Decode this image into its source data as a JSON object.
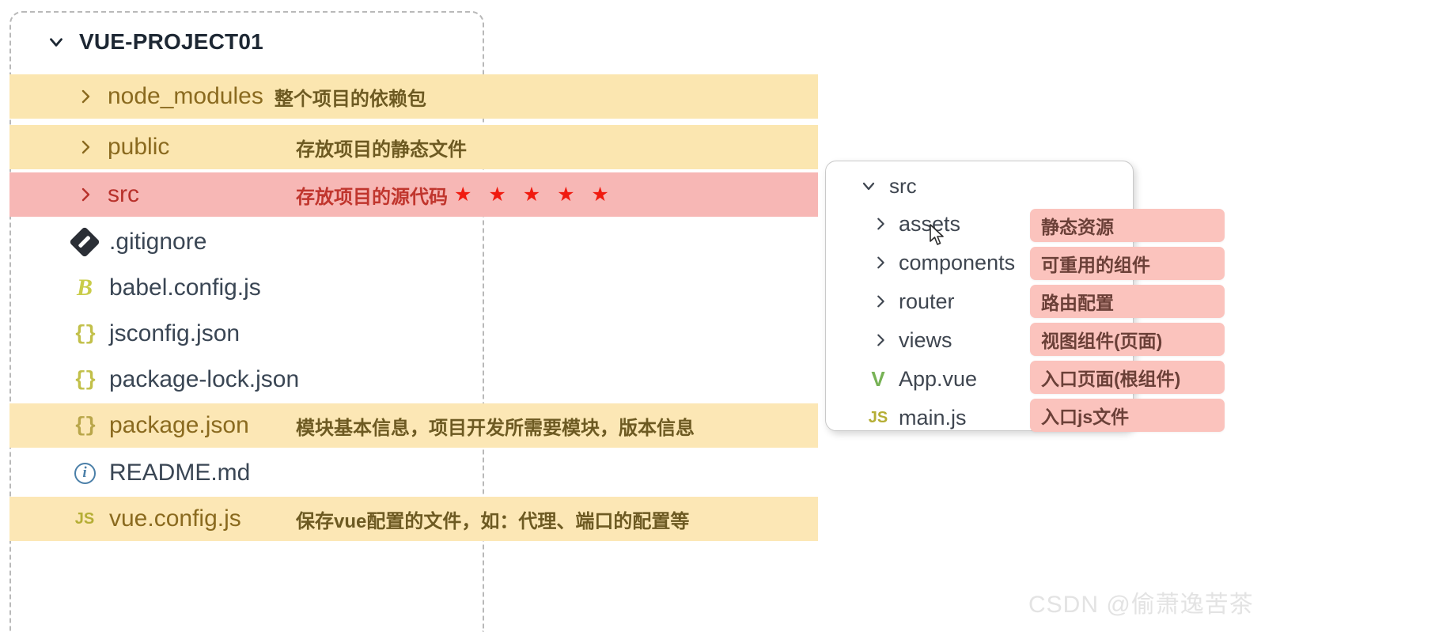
{
  "left_panel": {
    "root": {
      "label": "VUE-PROJECT01",
      "caret": "chevron-down-icon"
    },
    "rows": [
      {
        "name": "node_modules",
        "desc": "整个项目的依赖包",
        "icon": "chevron-right-icon",
        "kind": "folder",
        "highlight": "yellow"
      },
      {
        "name": "public",
        "desc": "存放项目的静态文件",
        "icon": "chevron-right-icon",
        "kind": "folder",
        "highlight": "yellow"
      },
      {
        "name": "src",
        "desc": "存放项目的源代码",
        "stars": "★ ★ ★ ★ ★",
        "icon": "chevron-right-icon",
        "kind": "folder",
        "highlight": "pink"
      },
      {
        "name": ".gitignore",
        "desc": "",
        "icon": "git-icon",
        "kind": "file",
        "highlight": "none"
      },
      {
        "name": "babel.config.js",
        "desc": "",
        "icon": "babel-icon",
        "kind": "file",
        "highlight": "none"
      },
      {
        "name": "jsconfig.json",
        "desc": "",
        "icon": "json-icon",
        "kind": "file",
        "highlight": "none"
      },
      {
        "name": "package-lock.json",
        "desc": "",
        "icon": "json-icon",
        "kind": "file",
        "highlight": "none"
      },
      {
        "name": "package.json",
        "desc": "模块基本信息，项目开发所需要模块，版本信息",
        "icon": "json-icon",
        "kind": "file",
        "highlight": "yellow"
      },
      {
        "name": "README.md",
        "desc": "",
        "icon": "markdown-info-icon",
        "kind": "file",
        "highlight": "none"
      },
      {
        "name": "vue.config.js",
        "desc": "保存vue配置的文件，如：代理、端口的配置等",
        "icon": "js-icon",
        "kind": "file",
        "highlight": "yellow"
      }
    ]
  },
  "right_panel": {
    "root": {
      "label": "src",
      "caret": "chevron-down-icon"
    },
    "rows": [
      {
        "name": "assets",
        "tag": "静态资源",
        "icon": "chevron-right-icon",
        "kind": "folder"
      },
      {
        "name": "components",
        "tag": "可重用的组件",
        "icon": "chevron-right-icon",
        "kind": "folder"
      },
      {
        "name": "router",
        "tag": "路由配置",
        "icon": "chevron-right-icon",
        "kind": "folder"
      },
      {
        "name": "views",
        "tag": "视图组件(页面)",
        "icon": "chevron-right-icon",
        "kind": "folder"
      },
      {
        "name": "App.vue",
        "tag": "入口页面(根组件)",
        "icon": "vue-icon",
        "kind": "file"
      },
      {
        "name": "main.js",
        "tag": "入口js文件",
        "icon": "js-icon",
        "kind": "file"
      }
    ]
  },
  "watermark": {
    "text": "CSDN @偷萧逸苦茶"
  },
  "colors": {
    "highlight_yellow": "#fbe6b0",
    "highlight_pink": "#f7b7b5",
    "tag_pink": "#fbc3bd",
    "star_red": "#f01a0f",
    "folder_text_amber": "#8a6a1f",
    "folder_text_crimson": "#b8312b"
  }
}
